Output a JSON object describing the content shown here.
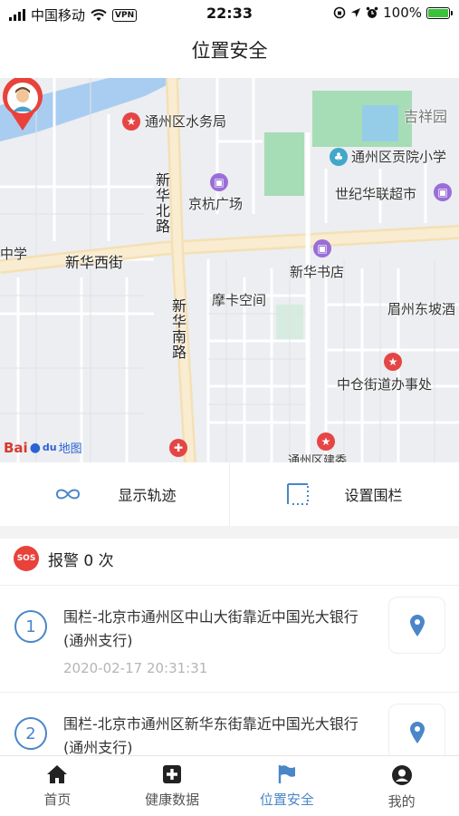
{
  "status_bar": {
    "carrier": "中国移动",
    "vpn": "VPN",
    "time": "22:33",
    "battery": "100%"
  },
  "nav": {
    "title": "位置安全"
  },
  "map": {
    "labels": {
      "water_bureau": "通州区水务局",
      "jinghang_plaza": "京杭广场",
      "xinhua_north": "新华北路",
      "xinhua_west": "新华西街",
      "middle_school": "中学",
      "jixiang": "吉祥园",
      "gongyuan_school": "通州区贡院小学",
      "century_market": "世纪华联超市",
      "xinhua_bookstore": "新华书店",
      "mofang": "摩卡空间",
      "meizhou": "眉州东坡酒",
      "xinhua_south": "新华南路",
      "zhongcang": "中仓街道办事处",
      "tongzhou_bottom": "通州区建委"
    },
    "logo": {
      "bai": "Bai",
      "du": "du",
      "tu": "地图"
    }
  },
  "actions": {
    "track": "显示轨迹",
    "fence": "设置围栏"
  },
  "alarm": {
    "sos_badge": "SOS",
    "title": "报警 0 次",
    "items": [
      {
        "index": "1",
        "text": "围栏-北京市通州区中山大街靠近中国光大银行(通州支行)",
        "time": "2020-02-17 20:31:31"
      },
      {
        "index": "2",
        "text": "围栏-北京市通州区新华东街靠近中国光大银行(通州支行)",
        "time": ""
      }
    ]
  },
  "tabbar": {
    "home": "首页",
    "health": "健康数据",
    "location": "位置安全",
    "mine": "我的"
  },
  "colors": {
    "accent": "#4a86c8",
    "alert_red": "#e8423b",
    "battery_green": "#3cc13b"
  }
}
